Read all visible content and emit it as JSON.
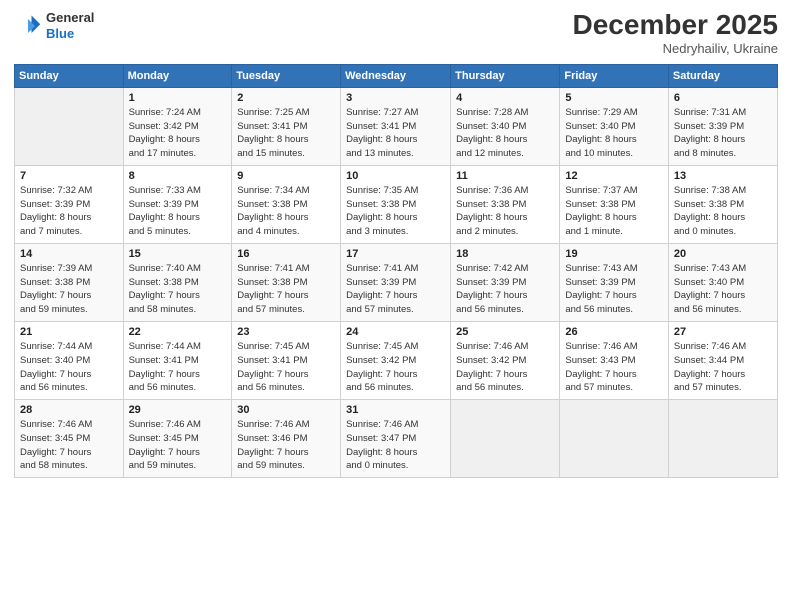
{
  "header": {
    "logo_line1": "General",
    "logo_line2": "Blue",
    "month": "December 2025",
    "location": "Nedryhailiv, Ukraine"
  },
  "weekdays": [
    "Sunday",
    "Monday",
    "Tuesday",
    "Wednesday",
    "Thursday",
    "Friday",
    "Saturday"
  ],
  "weeks": [
    [
      {
        "day": "",
        "detail": ""
      },
      {
        "day": "1",
        "detail": "Sunrise: 7:24 AM\nSunset: 3:42 PM\nDaylight: 8 hours\nand 17 minutes."
      },
      {
        "day": "2",
        "detail": "Sunrise: 7:25 AM\nSunset: 3:41 PM\nDaylight: 8 hours\nand 15 minutes."
      },
      {
        "day": "3",
        "detail": "Sunrise: 7:27 AM\nSunset: 3:41 PM\nDaylight: 8 hours\nand 13 minutes."
      },
      {
        "day": "4",
        "detail": "Sunrise: 7:28 AM\nSunset: 3:40 PM\nDaylight: 8 hours\nand 12 minutes."
      },
      {
        "day": "5",
        "detail": "Sunrise: 7:29 AM\nSunset: 3:40 PM\nDaylight: 8 hours\nand 10 minutes."
      },
      {
        "day": "6",
        "detail": "Sunrise: 7:31 AM\nSunset: 3:39 PM\nDaylight: 8 hours\nand 8 minutes."
      }
    ],
    [
      {
        "day": "7",
        "detail": "Sunrise: 7:32 AM\nSunset: 3:39 PM\nDaylight: 8 hours\nand 7 minutes."
      },
      {
        "day": "8",
        "detail": "Sunrise: 7:33 AM\nSunset: 3:39 PM\nDaylight: 8 hours\nand 5 minutes."
      },
      {
        "day": "9",
        "detail": "Sunrise: 7:34 AM\nSunset: 3:38 PM\nDaylight: 8 hours\nand 4 minutes."
      },
      {
        "day": "10",
        "detail": "Sunrise: 7:35 AM\nSunset: 3:38 PM\nDaylight: 8 hours\nand 3 minutes."
      },
      {
        "day": "11",
        "detail": "Sunrise: 7:36 AM\nSunset: 3:38 PM\nDaylight: 8 hours\nand 2 minutes."
      },
      {
        "day": "12",
        "detail": "Sunrise: 7:37 AM\nSunset: 3:38 PM\nDaylight: 8 hours\nand 1 minute."
      },
      {
        "day": "13",
        "detail": "Sunrise: 7:38 AM\nSunset: 3:38 PM\nDaylight: 8 hours\nand 0 minutes."
      }
    ],
    [
      {
        "day": "14",
        "detail": "Sunrise: 7:39 AM\nSunset: 3:38 PM\nDaylight: 7 hours\nand 59 minutes."
      },
      {
        "day": "15",
        "detail": "Sunrise: 7:40 AM\nSunset: 3:38 PM\nDaylight: 7 hours\nand 58 minutes."
      },
      {
        "day": "16",
        "detail": "Sunrise: 7:41 AM\nSunset: 3:38 PM\nDaylight: 7 hours\nand 57 minutes."
      },
      {
        "day": "17",
        "detail": "Sunrise: 7:41 AM\nSunset: 3:39 PM\nDaylight: 7 hours\nand 57 minutes."
      },
      {
        "day": "18",
        "detail": "Sunrise: 7:42 AM\nSunset: 3:39 PM\nDaylight: 7 hours\nand 56 minutes."
      },
      {
        "day": "19",
        "detail": "Sunrise: 7:43 AM\nSunset: 3:39 PM\nDaylight: 7 hours\nand 56 minutes."
      },
      {
        "day": "20",
        "detail": "Sunrise: 7:43 AM\nSunset: 3:40 PM\nDaylight: 7 hours\nand 56 minutes."
      }
    ],
    [
      {
        "day": "21",
        "detail": "Sunrise: 7:44 AM\nSunset: 3:40 PM\nDaylight: 7 hours\nand 56 minutes."
      },
      {
        "day": "22",
        "detail": "Sunrise: 7:44 AM\nSunset: 3:41 PM\nDaylight: 7 hours\nand 56 minutes."
      },
      {
        "day": "23",
        "detail": "Sunrise: 7:45 AM\nSunset: 3:41 PM\nDaylight: 7 hours\nand 56 minutes."
      },
      {
        "day": "24",
        "detail": "Sunrise: 7:45 AM\nSunset: 3:42 PM\nDaylight: 7 hours\nand 56 minutes."
      },
      {
        "day": "25",
        "detail": "Sunrise: 7:46 AM\nSunset: 3:42 PM\nDaylight: 7 hours\nand 56 minutes."
      },
      {
        "day": "26",
        "detail": "Sunrise: 7:46 AM\nSunset: 3:43 PM\nDaylight: 7 hours\nand 57 minutes."
      },
      {
        "day": "27",
        "detail": "Sunrise: 7:46 AM\nSunset: 3:44 PM\nDaylight: 7 hours\nand 57 minutes."
      }
    ],
    [
      {
        "day": "28",
        "detail": "Sunrise: 7:46 AM\nSunset: 3:45 PM\nDaylight: 7 hours\nand 58 minutes."
      },
      {
        "day": "29",
        "detail": "Sunrise: 7:46 AM\nSunset: 3:45 PM\nDaylight: 7 hours\nand 59 minutes."
      },
      {
        "day": "30",
        "detail": "Sunrise: 7:46 AM\nSunset: 3:46 PM\nDaylight: 7 hours\nand 59 minutes."
      },
      {
        "day": "31",
        "detail": "Sunrise: 7:46 AM\nSunset: 3:47 PM\nDaylight: 8 hours\nand 0 minutes."
      },
      {
        "day": "",
        "detail": ""
      },
      {
        "day": "",
        "detail": ""
      },
      {
        "day": "",
        "detail": ""
      }
    ]
  ]
}
